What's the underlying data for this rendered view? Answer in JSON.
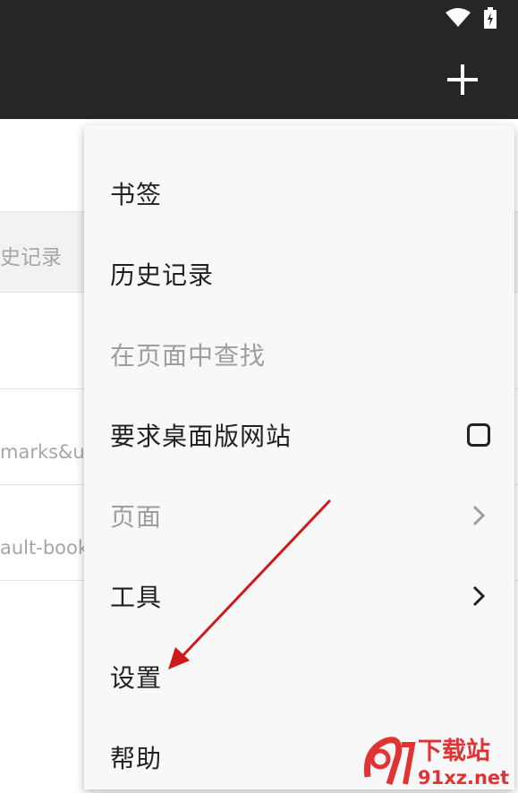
{
  "status_bar": {
    "icons": [
      "wifi-icon",
      "battery-charging-icon"
    ]
  },
  "toolbar": {
    "add_icon": "plus-icon"
  },
  "background_list": {
    "tab_fragment": "史记录",
    "row1_fragment": "marks&ut",
    "row2_fragment": "ault-book"
  },
  "menu": {
    "items": [
      {
        "label": "书签",
        "enabled": true,
        "trailing": "none"
      },
      {
        "label": "历史记录",
        "enabled": true,
        "trailing": "none"
      },
      {
        "label": "在页面中查找",
        "enabled": false,
        "trailing": "none"
      },
      {
        "label": "要求桌面版网站",
        "enabled": true,
        "trailing": "checkbox",
        "checked": false
      },
      {
        "label": "页面",
        "enabled": false,
        "trailing": "chevron-right-icon"
      },
      {
        "label": "工具",
        "enabled": true,
        "trailing": "chevron-right-icon"
      },
      {
        "label": "设置",
        "enabled": true,
        "trailing": "none"
      },
      {
        "label": "帮助",
        "enabled": true,
        "trailing": "none"
      }
    ]
  },
  "annotation": {
    "arrow_color": "#d01818",
    "points_to": "设置"
  },
  "watermark": {
    "text_top": "下载站",
    "text_bottom": "91xz.net",
    "color": "#e03434"
  }
}
